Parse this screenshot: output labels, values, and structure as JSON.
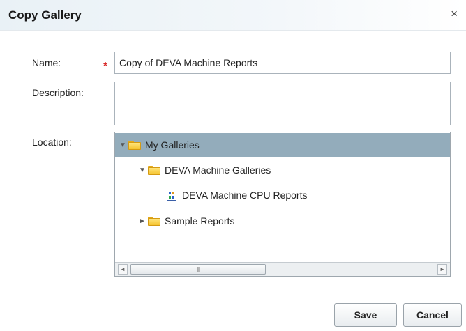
{
  "dialog": {
    "title": "Copy Gallery",
    "close_symbol": "×"
  },
  "form": {
    "name_label": "Name:",
    "required_marker": "*",
    "name_value": "Copy of DEVA Machine Reports",
    "description_label": "Description:",
    "description_value": "",
    "location_label": "Location:"
  },
  "tree": {
    "items": [
      {
        "label": "My Galleries",
        "type": "folder",
        "expanded": true,
        "selected": true,
        "level": 0
      },
      {
        "label": "DEVA Machine Galleries",
        "type": "folder",
        "expanded": true,
        "selected": false,
        "level": 1
      },
      {
        "label": "DEVA Machine CPU Reports",
        "type": "report",
        "selected": false,
        "level": 2
      },
      {
        "label": "Sample Reports",
        "type": "folder",
        "expanded": false,
        "selected": false,
        "level": 1
      }
    ],
    "expanded_arrow": "▼",
    "collapsed_arrow": "►"
  },
  "scrollbar": {
    "left_arrow": "◄",
    "right_arrow": "►",
    "grip": "||||"
  },
  "buttons": {
    "save": "Save",
    "cancel": "Cancel"
  },
  "colors": {
    "selected_row": "#93acbb",
    "required_marker": "#d92b2b"
  }
}
